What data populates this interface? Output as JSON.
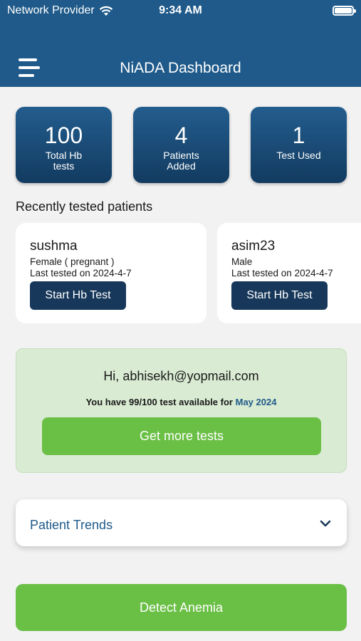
{
  "status_bar": {
    "carrier": "Network Provider",
    "time": "9:34 AM"
  },
  "header": {
    "title": "NiADA Dashboard"
  },
  "stats": [
    {
      "value": "100",
      "label": "Total Hb tests"
    },
    {
      "value": "4",
      "label": "Patients Added"
    },
    {
      "value": "1",
      "label": "Test Used"
    }
  ],
  "recent": {
    "title": "Recently tested patients",
    "patients": [
      {
        "name": "sushma",
        "info": "Female ( pregnant )",
        "last_tested": "Last tested on 2024-4-7",
        "button": "Start Hb Test"
      },
      {
        "name": "asim23",
        "info": "Male",
        "last_tested": "Last tested on 2024-4-7",
        "button": "Start Hb Test"
      }
    ]
  },
  "plan": {
    "greeting": "Hi, abhisekh@yopmail.com",
    "availability": "You have 99/100 test available for",
    "month": "May 2024",
    "button": "Get more tests"
  },
  "trends": {
    "label": "Patient Trends"
  },
  "detect": {
    "label": "Detect Anemia"
  },
  "colors": {
    "primary": "#1f5a8a",
    "dark": "#17385a",
    "accent_green": "#6abf45",
    "plan_bg": "#d9ebd3"
  }
}
